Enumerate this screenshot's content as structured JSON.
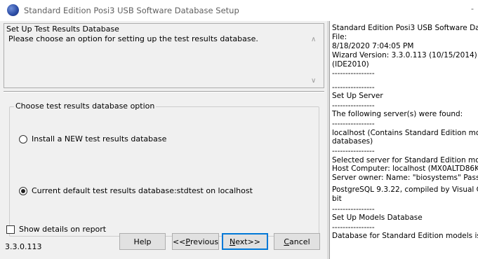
{
  "window": {
    "title": "Standard Edition Posi3 USB Software Database Setup",
    "min_glyph": "-"
  },
  "header": {
    "title": "Set Up Test Results Database",
    "description": "Please choose an option for setting up the test results database."
  },
  "options_group": {
    "legend": "Choose test results database option",
    "options": [
      {
        "label": "Install a NEW test results database",
        "selected": false
      },
      {
        "label": "Current default test results database:stdtest on localhost",
        "selected": true
      }
    ]
  },
  "show_details": {
    "label": "Show details on report",
    "checked": false
  },
  "version": "3.3.0.113",
  "buttons": {
    "help": "Help",
    "previous": {
      "prefix": "<<",
      "accel": "P",
      "rest": "revious"
    },
    "next": {
      "accel": "N",
      "rest": "ext>>"
    },
    "cancel": {
      "accel": "C",
      "rest": "ancel"
    }
  },
  "log": [
    "Standard Edition Posi3 USB Software Dat",
    "File:",
    "8/18/2020 7:04:05 PM",
    "Wizard Version: 3.3.0.113 (10/15/2014)",
    " (IDE2010)",
    "----------------",
    "----------------",
    "Set Up Server",
    "----------------",
    "The following server(s) were found:",
    "----------------",
    "localhost (Contains Standard Edition mod",
    "databases)",
    "----------------",
    "Selected server for Standard Edition mod",
    "Host Computer: localhost (MX0ALTD86K8",
    "Server owner: Name: \"biosystems\"  Pass",
    "PostgreSQL 9.3.22, compiled by Visual C",
    "bit",
    "----------------",
    "Set Up Models Database",
    "----------------",
    "Database for Standard Edition models is"
  ]
}
